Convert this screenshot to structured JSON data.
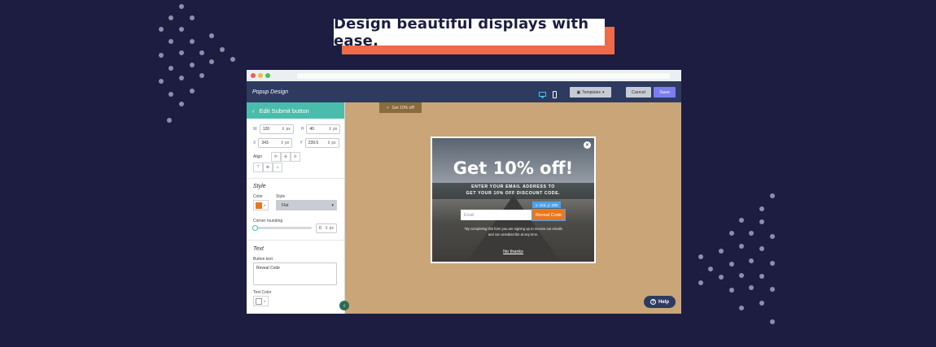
{
  "headline": "Design beautiful displays with ease.",
  "colors": {
    "background": "#1c1d40",
    "accent": "#ef6a48",
    "teal": "#4bbcab",
    "canvas": "#c9a577",
    "orange": "#e8781f"
  },
  "app": {
    "title": "Popup Design",
    "templates_label": "Templates",
    "cancel_label": "Cancel",
    "save_label": "Save",
    "device_icons": [
      "desktop-icon",
      "mobile-icon"
    ]
  },
  "panel": {
    "header": "Edit Submit button",
    "w_label": "W",
    "w_value": "120",
    "w_unit": "px",
    "h_label": "H",
    "h_value": "40",
    "h_unit": "px",
    "x_label": "X",
    "x_value": "343",
    "x_unit": "px",
    "y_label": "Y",
    "y_value": "239.5",
    "y_unit": "px",
    "align_label": "Align",
    "style_section": "Style",
    "color_label": "Color",
    "style_label": "Style",
    "style_value": "Flat",
    "corner_label": "Corner rounding",
    "corner_value": "0",
    "corner_unit": "px",
    "text_section": "Text",
    "button_text_label": "Button text",
    "button_text_value": "Reveal Code",
    "text_color_label": "Text Color"
  },
  "canvas": {
    "tab_label": "Get 10% off!",
    "popup": {
      "title": "Get 10% off!",
      "sub_line1": "ENTER YOUR EMAIL ADDRESS TO",
      "sub_line2": "GET YOUR 10% OFF DISCOUNT CODE.",
      "email_placeholder": "Email",
      "button_label": "Reveal Code",
      "coord_tag": "x: 343, y: 239",
      "disclaimer1": "*By completing this form you are signing up to receive our emails",
      "disclaimer2": "and can unsubscribe at any time.",
      "no_thanks": "No thanks"
    },
    "help_label": "Help"
  }
}
